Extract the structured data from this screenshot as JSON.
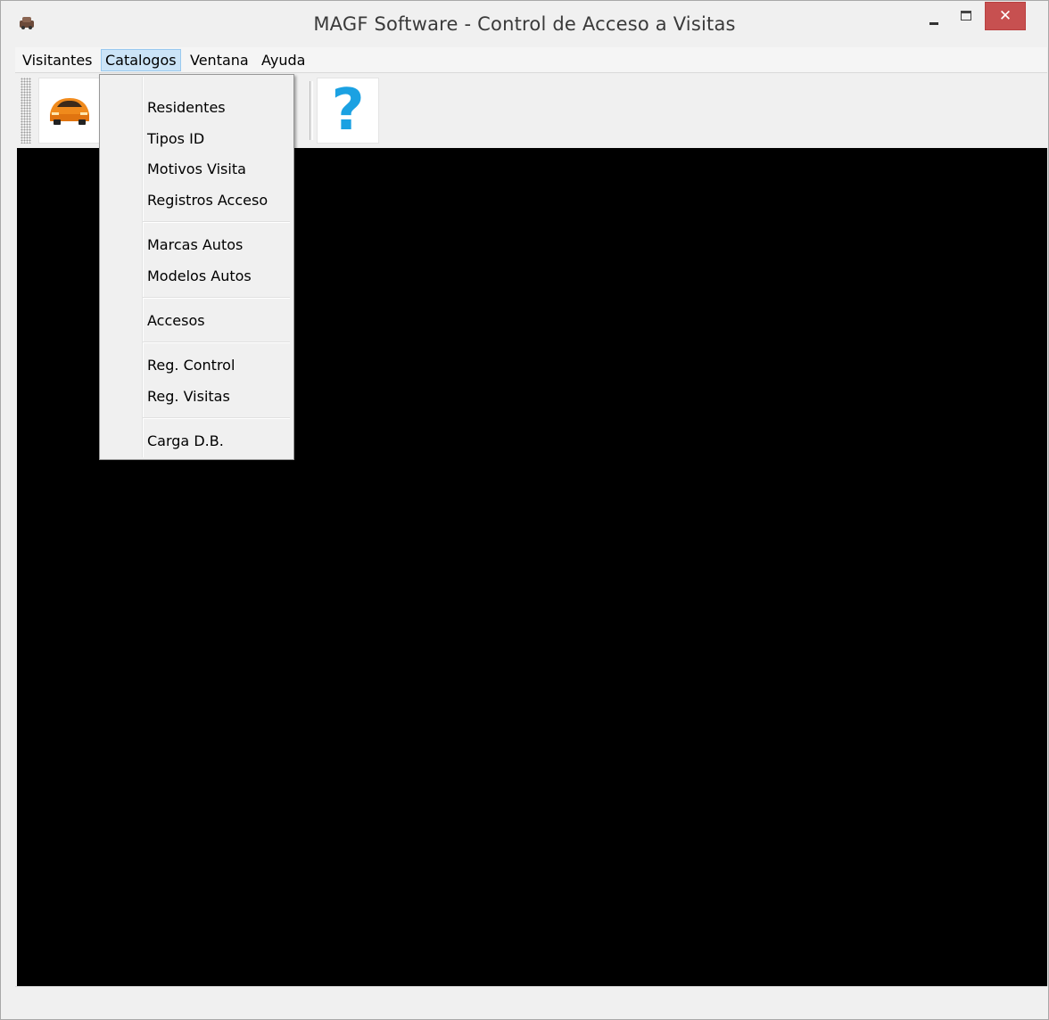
{
  "window": {
    "title": "MAGF Software - Control de Acceso a Visitas",
    "close_glyph": "✕"
  },
  "menubar": {
    "items": [
      {
        "label": "Visitantes"
      },
      {
        "label": "Catalogos"
      },
      {
        "label": "Ventana"
      },
      {
        "label": "Ayuda"
      }
    ],
    "active": "Catalogos"
  },
  "toolbar": {
    "buttons": [
      {
        "icon": "sports-car-icon"
      },
      {
        "icon": "help-icon",
        "glyph": "?"
      }
    ]
  },
  "dropdown": {
    "groups": [
      [
        "Residentes",
        "Tipos ID",
        "Motivos Visita",
        "Registros Acceso"
      ],
      [
        "Marcas Autos",
        "Modelos Autos"
      ],
      [
        "Accesos"
      ],
      [
        "Reg. Control",
        "Reg. Visitas"
      ],
      [
        "Carga D.B."
      ]
    ]
  },
  "colors": {
    "mdi_background": "#000000",
    "active_menu": "#cce4f7",
    "close_button": "#c75050",
    "help_icon": "#1ba1e2"
  }
}
